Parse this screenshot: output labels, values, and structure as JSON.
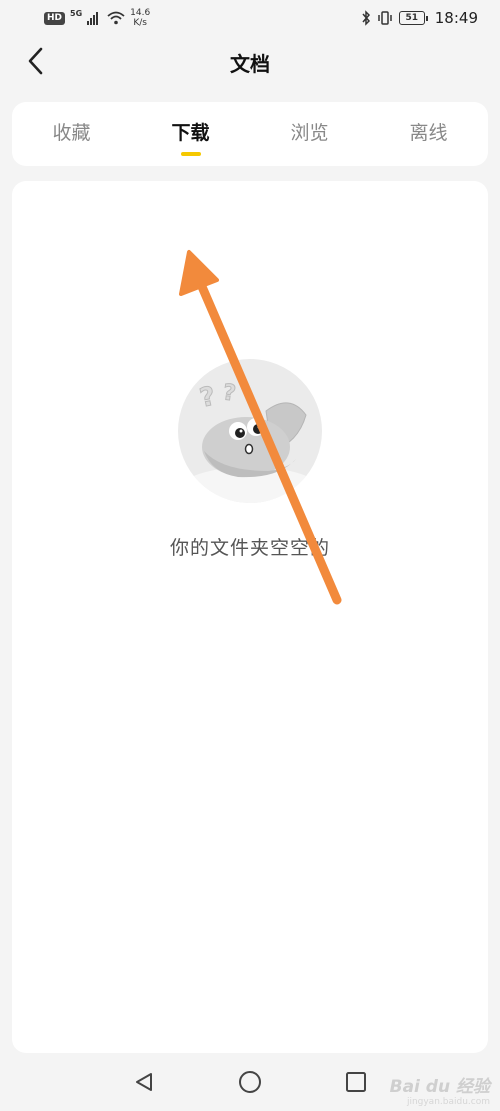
{
  "status_bar": {
    "hd_badge": "HD",
    "network": "5G",
    "speed_value": "14.6",
    "speed_unit": "K/s",
    "battery": "51",
    "time": "18:49"
  },
  "header": {
    "title": "文档"
  },
  "tabs": [
    {
      "label": "收藏",
      "active": false
    },
    {
      "label": "下载",
      "active": true
    },
    {
      "label": "浏览",
      "active": false
    },
    {
      "label": "离线",
      "active": false
    }
  ],
  "empty_state": {
    "message": "你的文件夹空空的"
  },
  "colors": {
    "tab_indicator": "#f5c800",
    "annotation_arrow": "#f28a3c"
  },
  "watermark": {
    "brand": "Bai du 经验",
    "url": "jingyan.baidu.com"
  }
}
